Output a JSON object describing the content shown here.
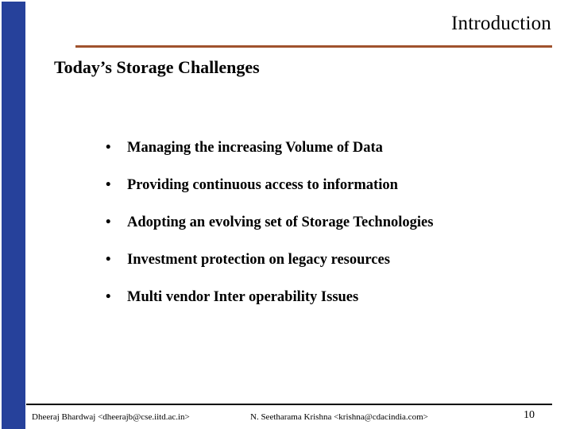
{
  "slide": {
    "title": "Introduction",
    "subtitle": "Today’s Storage Challenges",
    "accent_rule_color": "#A0522D",
    "sidebar_color": "#26419B",
    "bullet_marker": "•",
    "bullets": [
      {
        "text": "Managing the increasing Volume of Data"
      },
      {
        "text": "Providing continuous access to information"
      },
      {
        "text": "Adopting an evolving set of Storage Technologies"
      },
      {
        "text": "Investment protection on legacy resources"
      },
      {
        "text": "Multi vendor Inter operability Issues"
      }
    ]
  },
  "footer": {
    "author_1": "Dheeraj Bhardwaj <dheerajb@cse.iitd.ac.in>",
    "author_2": "N. Seetharama Krishna <krishna@cdacindia.com>",
    "page_number": "10"
  }
}
